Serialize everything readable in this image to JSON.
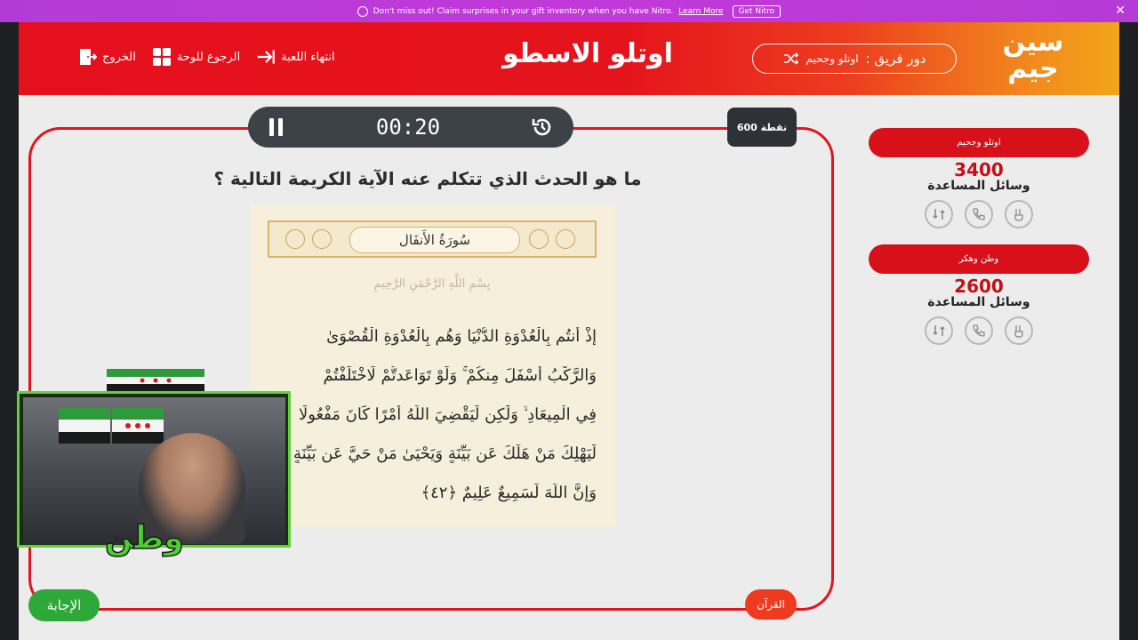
{
  "nitro": {
    "message": "Don't miss out! Claim surprises in your gift inventory when you have Nitro.",
    "learn_more": "Learn More",
    "cta": "Get Nitro",
    "close": "✕"
  },
  "header": {
    "logo_text": "سين جيم",
    "turn_label": "دور فريق :",
    "turn_team": "اوتلو وجحيم",
    "title": "اوتلو الاسطو",
    "nav": {
      "end_game": "انتهاء اللعبة",
      "back_to_board": "الرجوع للوحة",
      "exit": "الخروج"
    }
  },
  "teams": [
    {
      "name": "اوتلو وجحيم",
      "score": "3400",
      "aids_label": "وسائل المساعدة"
    },
    {
      "name": "وطن وهكر",
      "score": "2600",
      "aids_label": "وسائل المساعدة"
    }
  ],
  "question": {
    "timer": "00:20",
    "points": "600 نقطة",
    "text": "ما هو الحدث الذي تتكلم عنه الآية الكريمة التالية ؟",
    "surah": "سُورَةُ الأَنفَال",
    "basmala": "بِسْمِ اللَّهِ الرَّحْمَنِ الرَّحِيمِ",
    "ayah_lines": [
      "إِذْ أَنتُم بِالْعُدْوَةِ الدُّنْيَا وَهُم بِالْعُدْوَةِ الْقُصْوَىٰ",
      "وَالرَّكْبُ أَسْفَلَ مِنكُمْ ۚ وَلَوْ تَوَاعَدتُّمْ لَاخْتَلَفْتُمْ",
      "فِي الْمِيعَادِ ۙ وَلَٰكِن لِّيَقْضِيَ اللَّهُ أَمْرًا كَانَ مَفْعُولًا",
      "لِّيَهْلِكَ مَنْ هَلَكَ عَن بَيِّنَةٍ وَيَحْيَىٰ مَنْ حَيَّ عَن بَيِّنَةٍ",
      "وَإِنَّ اللَّهَ لَسَمِيعٌ عَلِيمٌ ﴿٤٢﴾"
    ]
  },
  "buttons": {
    "answer": "الإجابة",
    "category": "القرآن"
  },
  "webcam": {
    "label": "وطن"
  },
  "colors": {
    "header_red": "#e5101d",
    "header_orange": "#f2a51a",
    "accent_red": "#d8101a",
    "answer_green": "#2fa83a",
    "category_orange": "#ee3b1f",
    "timer_bg": "#3d4148",
    "nitro_purple": "#b23bd6"
  }
}
